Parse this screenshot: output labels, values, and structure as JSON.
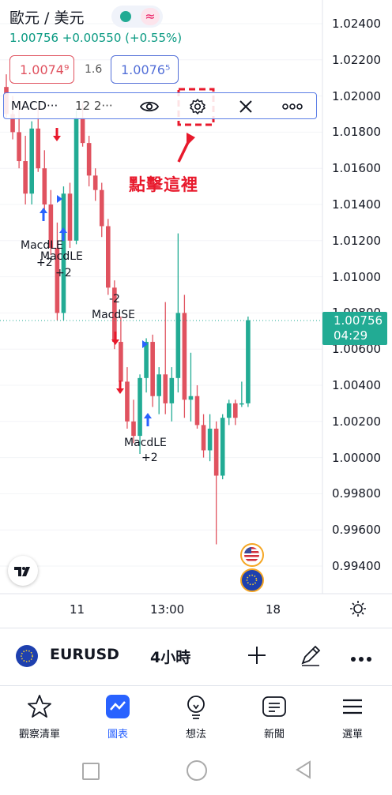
{
  "header": {
    "title": "歐元 / 美元",
    "quote": "1.00756 +0.00550 (+0.55%)",
    "toggle_wave": "≈"
  },
  "prices": {
    "bid": "1.0074⁹",
    "spread": "1.6",
    "ask": "1.0076⁵"
  },
  "indicator": {
    "name": "MACD···",
    "params": "12 2···"
  },
  "callout": "點擊這裡",
  "price_axis": [
    "1.02400",
    "1.02200",
    "1.02000",
    "1.01800",
    "1.01600",
    "1.01400",
    "1.01200",
    "1.01000",
    "1.00800",
    "1.00600",
    "1.00400",
    "1.00200",
    "1.00000",
    "0.99800",
    "0.99600",
    "0.99400"
  ],
  "current": {
    "price": "1.00756",
    "countdown": "04:29"
  },
  "signals": [
    {
      "text": "MacdLE"
    },
    {
      "text": "+2"
    },
    {
      "text": "MacdLE"
    },
    {
      "text": "+2"
    },
    {
      "text": "-2"
    },
    {
      "text": "MacdSE"
    },
    {
      "text": "MacdLE"
    },
    {
      "text": "+2"
    }
  ],
  "time_axis": [
    "11",
    "13:00",
    "18"
  ],
  "symbol": {
    "name": "EURUSD",
    "interval": "4小時"
  },
  "nav": [
    "觀察清單",
    "圖表",
    "想法",
    "新聞",
    "選單"
  ],
  "colors": {
    "up": "#22ab94",
    "down": "#e0525f",
    "accent": "#2962ff",
    "callout": "#e8192c"
  }
}
